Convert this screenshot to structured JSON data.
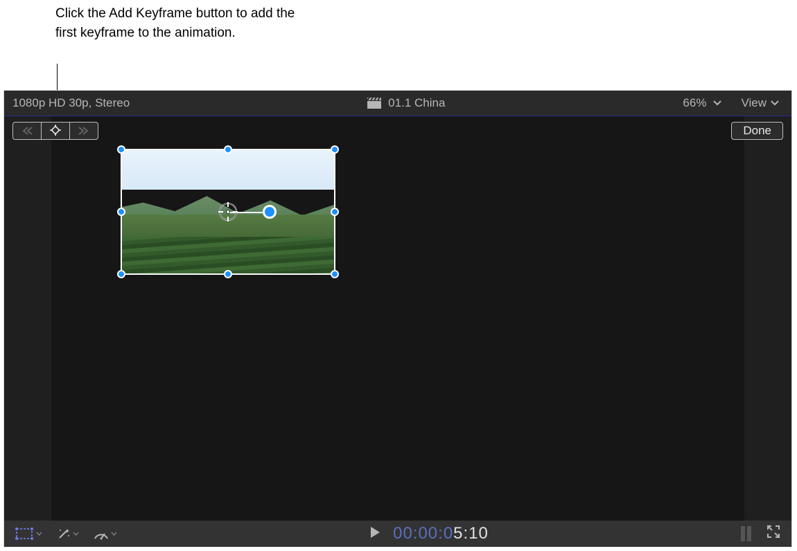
{
  "callout": {
    "text": "Click the Add Keyframe button to add the first keyframe to the animation."
  },
  "title_bar": {
    "format": "1080p HD 30p, Stereo",
    "clip_name": "01.1 China",
    "zoom": "66%",
    "view_label": "View"
  },
  "viewer": {
    "done_label": "Done"
  },
  "timecode": {
    "prefix": "00:00:0",
    "highlight": "5:10"
  },
  "icons": {
    "prev_keyframe": "prev-keyframe-icon",
    "add_keyframe": "add-keyframe-icon",
    "next_keyframe": "next-keyframe-icon",
    "clapperboard": "clapperboard-icon",
    "transform_tool": "transform-tool-icon",
    "effects_tool": "effects-wand-icon",
    "retime_tool": "retime-speedometer-icon",
    "play": "play-icon",
    "fullscreen": "fullscreen-icon"
  }
}
